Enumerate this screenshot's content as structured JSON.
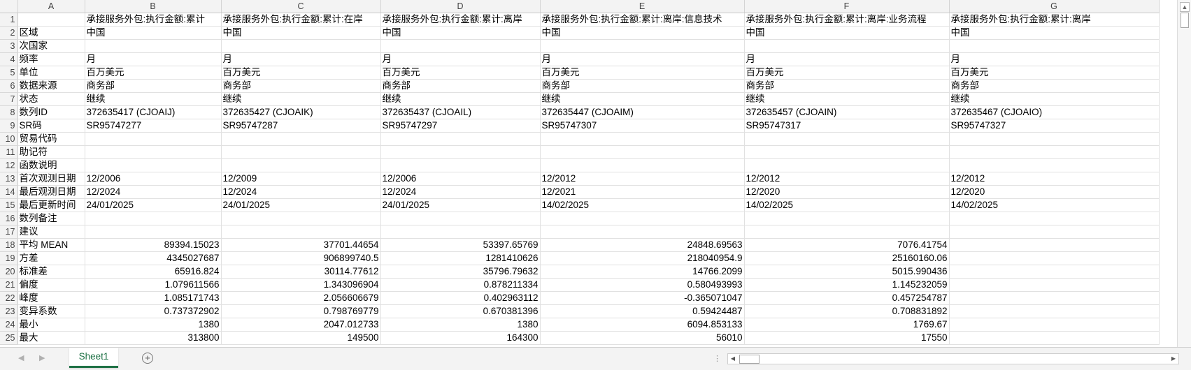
{
  "sheet": {
    "columns": [
      "A",
      "B",
      "C",
      "D",
      "E",
      "F",
      "G"
    ],
    "rows": [
      {
        "n": "1",
        "cells": [
          "",
          "承接服务外包:执行金额:累计",
          "承接服务外包:执行金额:累计:在岸",
          "承接服务外包:执行金额:累计:离岸",
          "承接服务外包:执行金额:累计:离岸:信息技术",
          "承接服务外包:执行金额:累计:离岸:业务流程",
          "承接服务外包:执行金额:累计:离岸"
        ]
      },
      {
        "n": "2",
        "cells": [
          "区域",
          "中国",
          "中国",
          "中国",
          "中国",
          "中国",
          "中国"
        ]
      },
      {
        "n": "3",
        "cells": [
          "次国家",
          "",
          "",
          "",
          "",
          "",
          ""
        ]
      },
      {
        "n": "4",
        "cells": [
          "频率",
          "月",
          "月",
          "月",
          "月",
          "月",
          "月"
        ]
      },
      {
        "n": "5",
        "cells": [
          "单位",
          "百万美元",
          "百万美元",
          "百万美元",
          "百万美元",
          "百万美元",
          "百万美元"
        ]
      },
      {
        "n": "6",
        "cells": [
          "数据来源",
          "商务部",
          "商务部",
          "商务部",
          "商务部",
          "商务部",
          "商务部"
        ]
      },
      {
        "n": "7",
        "cells": [
          "状态",
          "继续",
          "继续",
          "继续",
          "继续",
          "继续",
          "继续"
        ]
      },
      {
        "n": "8",
        "cells": [
          "数列ID",
          "372635417 (CJOAIJ)",
          "372635427 (CJOAIK)",
          "372635437 (CJOAIL)",
          "372635447 (CJOAIM)",
          "372635457 (CJOAIN)",
          "372635467 (CJOAIO)"
        ]
      },
      {
        "n": "9",
        "cells": [
          "SR码",
          "SR95747277",
          "SR95747287",
          "SR95747297",
          "SR95747307",
          "SR95747317",
          "SR95747327"
        ]
      },
      {
        "n": "10",
        "cells": [
          "贸易代码",
          "",
          "",
          "",
          "",
          "",
          ""
        ]
      },
      {
        "n": "11",
        "cells": [
          "助记符",
          "",
          "",
          "",
          "",
          "",
          ""
        ]
      },
      {
        "n": "12",
        "cells": [
          "函数说明",
          "",
          "",
          "",
          "",
          "",
          ""
        ]
      },
      {
        "n": "13",
        "cells": [
          "首次观测日期",
          "12/2006",
          "12/2009",
          "12/2006",
          "12/2012",
          "12/2012",
          "12/2012"
        ]
      },
      {
        "n": "14",
        "cells": [
          "最后观测日期",
          "12/2024",
          "12/2024",
          "12/2024",
          "12/2021",
          "12/2020",
          "12/2020"
        ]
      },
      {
        "n": "15",
        "cells": [
          "最后更新时间",
          "24/01/2025",
          "24/01/2025",
          "24/01/2025",
          "14/02/2025",
          "14/02/2025",
          "14/02/2025"
        ]
      },
      {
        "n": "16",
        "cells": [
          "数列备注",
          "",
          "",
          "",
          "",
          "",
          ""
        ]
      },
      {
        "n": "17",
        "cells": [
          "建议",
          "",
          "",
          "",
          "",
          "",
          ""
        ]
      },
      {
        "n": "18",
        "cells": [
          "平均 MEAN",
          "89394.15023",
          "37701.44654",
          "53397.65769",
          "24848.69563",
          "7076.41754",
          ""
        ]
      },
      {
        "n": "19",
        "cells": [
          "方差",
          "4345027687",
          "906899740.5",
          "1281410626",
          "218040954.9",
          "25160160.06",
          ""
        ]
      },
      {
        "n": "20",
        "cells": [
          "标准差",
          "65916.824",
          "30114.77612",
          "35796.79632",
          "14766.2099",
          "5015.990436",
          ""
        ]
      },
      {
        "n": "21",
        "cells": [
          "偏度",
          "1.079611566",
          "1.343096904",
          "0.878211334",
          "0.580493993",
          "1.145232059",
          ""
        ]
      },
      {
        "n": "22",
        "cells": [
          "峰度",
          "1.085171743",
          "2.056606679",
          "0.402963112",
          "-0.365071047",
          "0.457254787",
          ""
        ]
      },
      {
        "n": "23",
        "cells": [
          "变异系数",
          "0.737372902",
          "0.798769779",
          "0.670381396",
          "0.59424487",
          "0.708831892",
          ""
        ]
      },
      {
        "n": "24",
        "cells": [
          "最小",
          "1380",
          "2047.012733",
          "1380",
          "6094.853133",
          "1769.67",
          ""
        ]
      },
      {
        "n": "25",
        "cells": [
          "最大",
          "313800",
          "149500",
          "164300",
          "56010",
          "17550",
          ""
        ]
      }
    ]
  },
  "tabs": {
    "active": "Sheet1"
  },
  "icons": {
    "prev": "prev-sheet-icon",
    "next": "next-sheet-icon",
    "add": "add-sheet-icon"
  }
}
